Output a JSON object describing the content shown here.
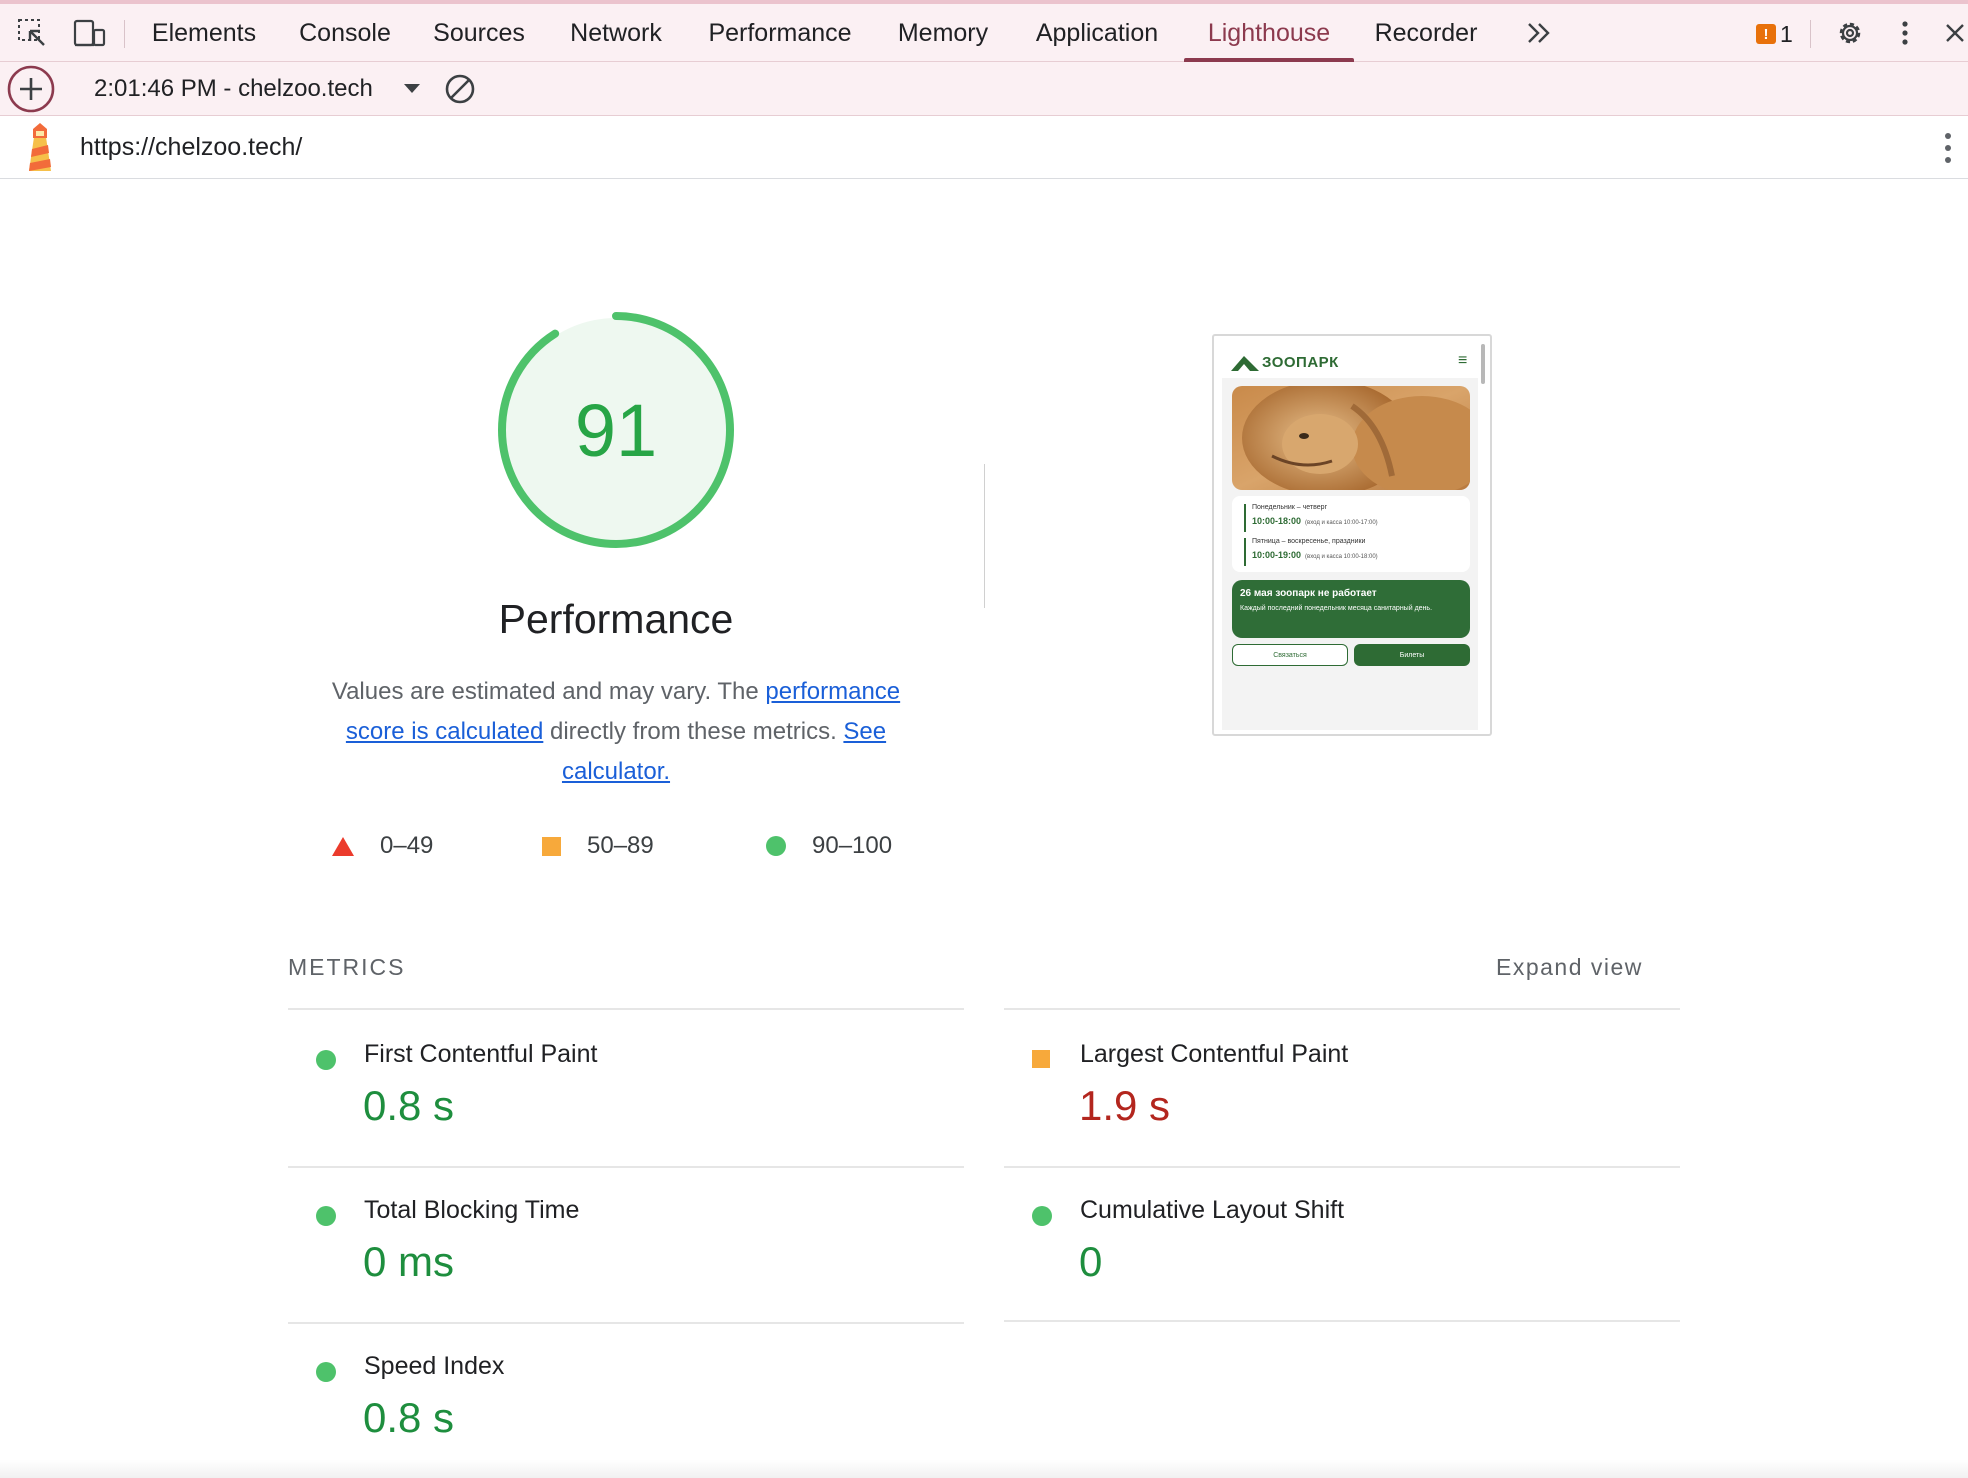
{
  "tabbar": {
    "tabs": [
      {
        "label": "Elements",
        "active": false
      },
      {
        "label": "Console",
        "active": false
      },
      {
        "label": "Sources",
        "active": false
      },
      {
        "label": "Network",
        "active": false
      },
      {
        "label": "Performance",
        "active": false
      },
      {
        "label": "Memory",
        "active": false
      },
      {
        "label": "Application",
        "active": false
      },
      {
        "label": "Lighthouse",
        "active": true
      },
      {
        "label": "Recorder",
        "active": false
      }
    ],
    "issues_count": "1",
    "accent_color": "#8c3a4e",
    "icons": [
      "inspect-element-icon",
      "device-toolbar-icon",
      "more-tabs-chevron-icon",
      "issues-icon",
      "settings-gear-icon",
      "more-options-icon",
      "close-icon"
    ]
  },
  "toolbar": {
    "report_label": "2:01:46 PM - chelzoo.tech",
    "icons": [
      "new-report-plus-icon",
      "dropdown-caret-icon",
      "clear-reports-icon"
    ]
  },
  "urlbar": {
    "url": "https://chelzoo.tech/",
    "icons": [
      "lighthouse-logo-icon",
      "report-menu-icon"
    ]
  },
  "gauge": {
    "score": "91",
    "score_fraction": 0.91,
    "title": "Performance",
    "color": "#4ec26b",
    "fill_color": "#eef8f0"
  },
  "description": {
    "text_before": "Values are estimated and may vary. The ",
    "link1": "performance score is calculated",
    "text_middle": " directly from these metrics. ",
    "link2": "See calculator."
  },
  "legend": [
    {
      "range": "0–49",
      "shape": "triangle",
      "color": "#eb3b2c"
    },
    {
      "range": "50–89",
      "shape": "square",
      "color": "#f7a93b"
    },
    {
      "range": "90–100",
      "shape": "circle",
      "color": "#4ec26b"
    }
  ],
  "screenshot": {
    "logo": "ЗООПАРК",
    "row1_label": "Понедельник – четверг",
    "row1_time": "10:00-18:00",
    "row1_note": "(вход и касса 10:00-17:00)",
    "row2_label": "Пятница – воскресенье, праздники",
    "row2_time": "10:00-19:00",
    "row2_note": "(вход и касса 10:00-18:00)",
    "alert_title": "26 мая зоопарк не работает",
    "alert_text": "Каждый последний понедельник месяца санитарный день.",
    "button1": "Связаться",
    "button2": "Билеты"
  },
  "metrics": {
    "header": "METRICS",
    "expand_label": "Expand view",
    "items": [
      {
        "name": "First Contentful Paint",
        "value": "0.8 s",
        "rating": "pass"
      },
      {
        "name": "Largest Contentful Paint",
        "value": "1.9 s",
        "rating": "average"
      },
      {
        "name": "Total Blocking Time",
        "value": "0 ms",
        "rating": "pass"
      },
      {
        "name": "Cumulative Layout Shift",
        "value": "0",
        "rating": "pass"
      },
      {
        "name": "Speed Index",
        "value": "0.8 s",
        "rating": "pass"
      }
    ]
  }
}
